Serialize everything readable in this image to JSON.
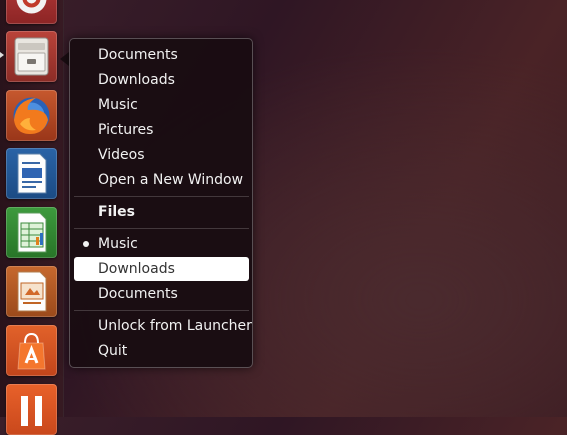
{
  "launcher": {
    "items": [
      {
        "name": "ubuntu-one"
      },
      {
        "name": "files"
      },
      {
        "name": "firefox"
      },
      {
        "name": "libreoffice-writer"
      },
      {
        "name": "libreoffice-calc"
      },
      {
        "name": "libreoffice-impress"
      },
      {
        "name": "ubuntu-software-center"
      },
      {
        "name": "app"
      }
    ]
  },
  "menu": {
    "bookmarks": [
      "Documents",
      "Downloads",
      "Music",
      "Pictures",
      "Videos"
    ],
    "new_window": "Open a New Window",
    "app_title": "Files",
    "windows": [
      {
        "label": "Music",
        "active": true
      },
      {
        "label": "Downloads",
        "highlighted": true
      },
      {
        "label": "Documents"
      }
    ],
    "unlock": "Unlock from Launcher",
    "quit": "Quit"
  },
  "colors": {
    "highlight": "#ffffff",
    "menu_bg": "#190c12",
    "text": "#f2f2f2"
  }
}
